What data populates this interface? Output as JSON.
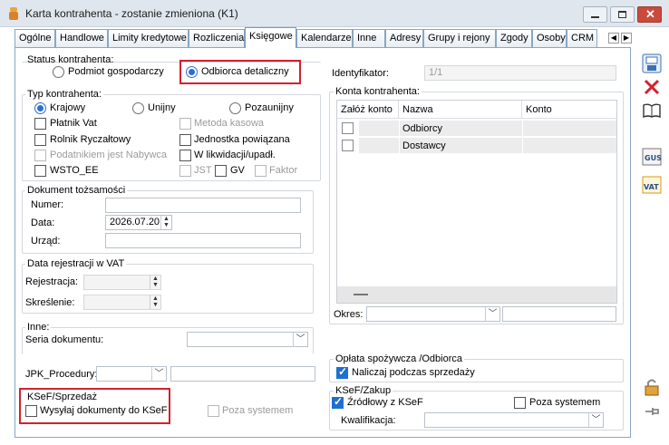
{
  "window": {
    "title": "Karta kontrahenta - zostanie zmieniona (K1)"
  },
  "tabs": [
    "Ogólne",
    "Handlowe",
    "Limity kredytowe",
    "Rozliczenia",
    "Księgowe",
    "Kalendarze",
    "Inne",
    "Adresy",
    "Grupy i rejony",
    "Zgody",
    "Osoby",
    "CRM"
  ],
  "status": {
    "title": "Status kontrahenta:",
    "opt1": "Podmiot gospodarczy",
    "opt2": "Odbiorca detaliczny"
  },
  "typ": {
    "title": "Typ kontrahenta:",
    "krajowy": "Krajowy",
    "unijny": "Unijny",
    "pozaunijny": "Pozaunijny",
    "platnik_vat": "Płatnik Vat",
    "metoda_kasowa": "Metoda kasowa",
    "rolnik": "Rolnik Ryczałtowy",
    "jednostka": "Jednostka powiązana",
    "podatnikiem": "Podatnikiem jest Nabywca",
    "likwidacji": "W likwidacji/upadł.",
    "wsto": "WSTO_EE",
    "jst": "JST",
    "gv": "GV",
    "faktor": "Faktor"
  },
  "dokument": {
    "title": "Dokument tożsamości",
    "numer": "Numer:",
    "data": "Data:",
    "data_value": "2026.07.20",
    "urzad": "Urząd:"
  },
  "vat": {
    "title": "Data rejestracji w VAT",
    "rejestracja": "Rejestracja:",
    "skreslenie": "Skreślenie:"
  },
  "inne": {
    "title": "Inne:",
    "seria": "Seria dokumentu:"
  },
  "jpk": {
    "label": "JPK_Procedury:"
  },
  "ksef_sprzedaz": {
    "title": "KSeF/Sprzedaż",
    "wysylaj": "Wysyłaj dokumenty do KSeF",
    "poza": "Poza systemem"
  },
  "identyfikator": {
    "label": "Identyfikator:",
    "value": "1/1"
  },
  "konta": {
    "title": "Konta kontrahenta:",
    "columns": [
      "Załóż konto",
      "Nazwa",
      "Konto"
    ],
    "rows": [
      {
        "nazwa": "Odbiorcy",
        "konto": ""
      },
      {
        "nazwa": "Dostawcy",
        "konto": ""
      }
    ],
    "okres": "Okres:"
  },
  "oplata": {
    "title": "Opłata spożywcza /Odbiorca",
    "naliczaj": "Naliczaj podczas sprzedaży"
  },
  "ksef_zakup": {
    "title": "KSeF/Zakup",
    "zrodlowy": "Źródłowy z KSeF",
    "poza": "Poza systemem",
    "kwalifikacja": "Kwalifikacja:"
  },
  "sidebar": {
    "icons": [
      "save-icon",
      "close-icon",
      "book-icon",
      "gus-icon",
      "vat-icon",
      "lock-icon",
      "pin-icon"
    ]
  },
  "colors": {
    "highlight_border": "#d3212d",
    "accent": "#1f6fd1"
  }
}
